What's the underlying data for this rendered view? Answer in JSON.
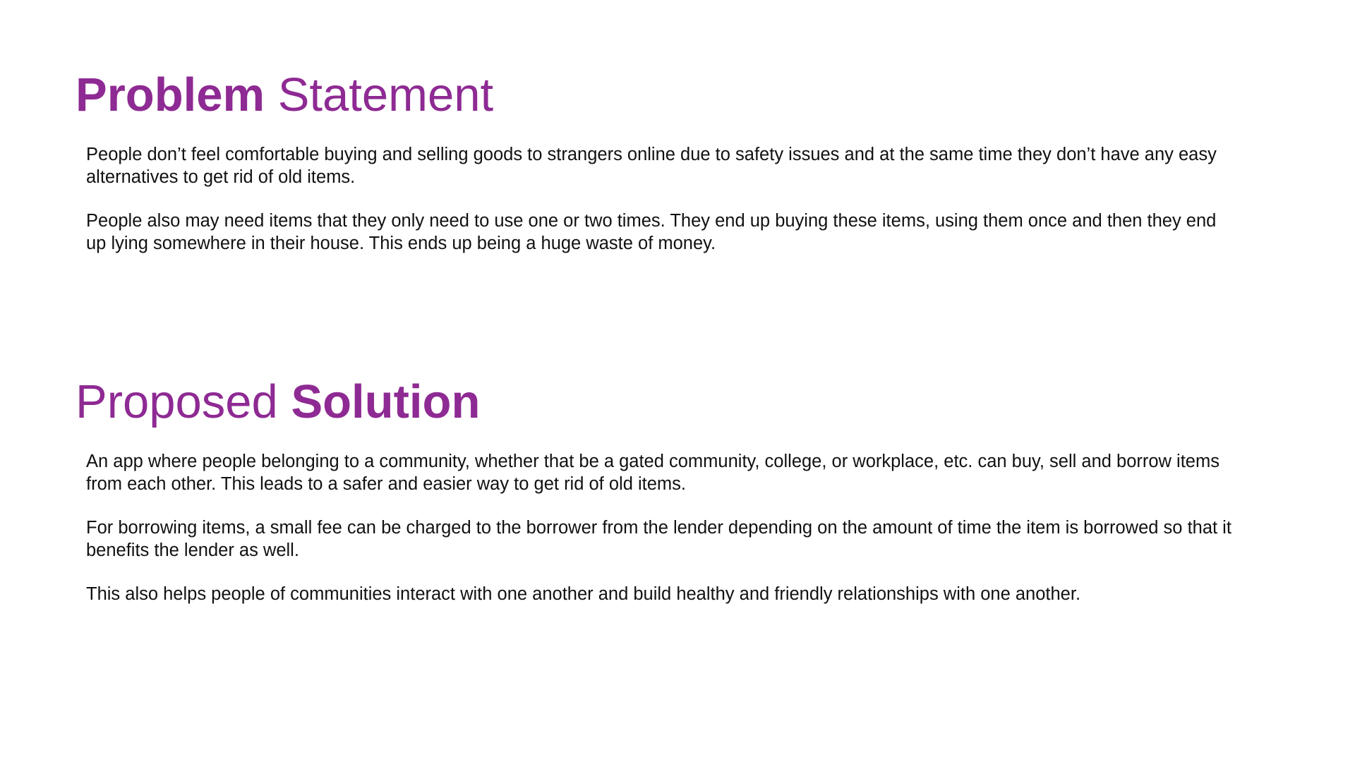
{
  "colors": {
    "heading": "#8e2a93",
    "text": "#111111",
    "background": "#ffffff"
  },
  "problem": {
    "heading_bold": "Problem",
    "heading_regular": "Statement",
    "paragraphs": [
      "People don’t feel comfortable buying and selling goods to strangers online due to safety issues and at the same time they don’t have any easy alternatives to get rid of old items.",
      "People also may need items that they only need to use one or two times. They end up buying these items, using them once and then they end up lying somewhere in their house. This ends up being a huge waste of money."
    ]
  },
  "solution": {
    "heading_regular": "Proposed",
    "heading_bold": "Solution",
    "paragraphs": [
      "An app where people belonging to a community, whether that be a gated community, college, or workplace, etc. can buy, sell and borrow items from each other. This leads to a safer and easier way to get rid of old items.",
      "For borrowing items, a small fee can be charged to the borrower from the lender depending on the amount of time the item is borrowed so that it benefits the lender as well.",
      "This also helps people of communities interact with one another and build healthy and friendly relationships with one another."
    ]
  }
}
